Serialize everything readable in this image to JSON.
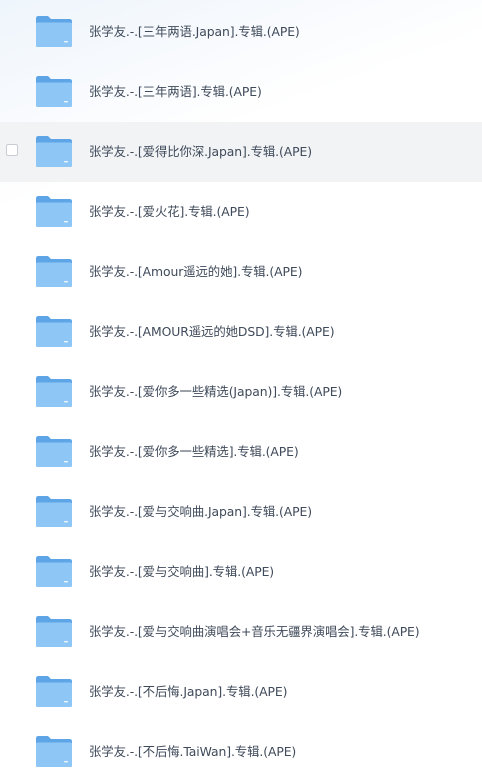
{
  "files": [
    {
      "name": "张学友.-.[三年两语.Japan].专辑.(APE)"
    },
    {
      "name": "张学友.-.[三年两语].专辑.(APE)"
    },
    {
      "name": "张学友.-.[爱得比你深.Japan].专辑.(APE)"
    },
    {
      "name": "张学友.-.[爱火花].专辑.(APE)"
    },
    {
      "name": "张学友.-.[Amour遥远的她].专辑.(APE)"
    },
    {
      "name": "张学友.-.[AMOUR遥远的她DSD].专辑.(APE)"
    },
    {
      "name": "张学友.-.[爱你多一些精选(Japan)].专辑.(APE)"
    },
    {
      "name": "张学友.-.[爱你多一些精选].专辑.(APE)"
    },
    {
      "name": "张学友.-.[爱与交响曲.Japan].专辑.(APE)"
    },
    {
      "name": "张学友.-.[爱与交响曲].专辑.(APE)"
    },
    {
      "name": "张学友.-.[爱与交响曲演唱会+音乐无疆界演唱会].专辑.(APE)"
    },
    {
      "name": "张学友.-.[不后悔.Japan].专辑.(APE)"
    },
    {
      "name": "张学友.-.[不后悔.TaiWan].专辑.(APE)"
    }
  ],
  "hovered_row_index": 2,
  "icons": {
    "folder": "folder-icon",
    "checkbox": "checkbox"
  },
  "colors": {
    "folder_back": "#5ea5e8",
    "folder_front": "#8ec6f5",
    "text": "#3f4a5a",
    "hover_bg": "#f2f3f5"
  }
}
